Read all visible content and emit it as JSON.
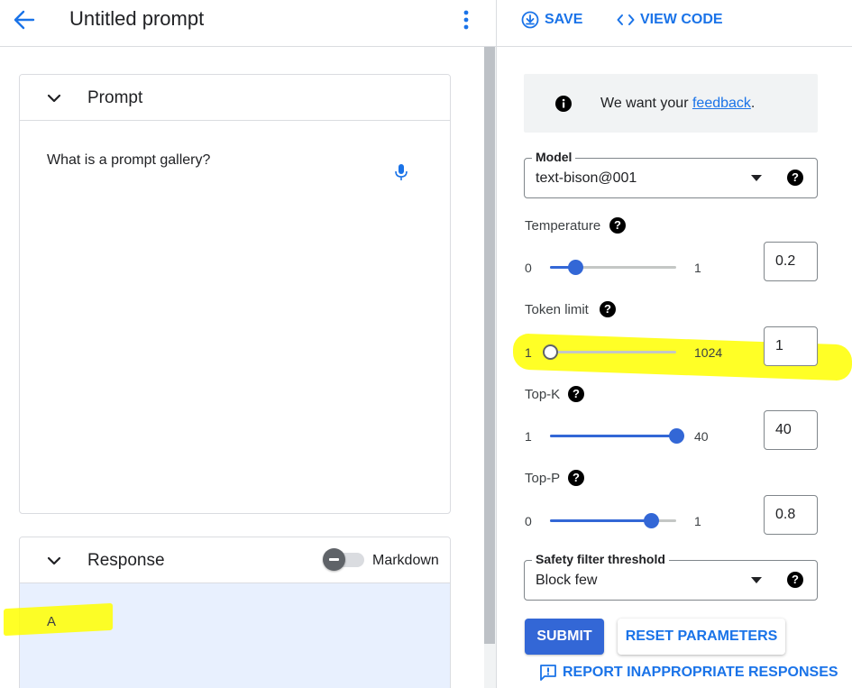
{
  "header": {
    "title": "Untitled prompt",
    "save_label": "SAVE",
    "view_code_label": "VIEW CODE"
  },
  "prompt_card": {
    "title": "Prompt",
    "text": "What is a prompt gallery?"
  },
  "response_card": {
    "title": "Response",
    "markdown_label": "Markdown",
    "markdown_enabled": false,
    "text": "A"
  },
  "feedback": {
    "prefix": "We want your ",
    "link": "feedback",
    "suffix": "."
  },
  "model": {
    "label": "Model",
    "value": "text-bison@001"
  },
  "parameters": {
    "temperature": {
      "label": "Temperature",
      "min": "0",
      "max": "1",
      "value": "0.2",
      "fraction": 0.2
    },
    "token_limit": {
      "label": "Token limit",
      "min": "1",
      "max": "1024",
      "value": "1",
      "fraction": 0.0
    },
    "top_k": {
      "label": "Top-K",
      "min": "1",
      "max": "40",
      "value": "40",
      "fraction": 1.0
    },
    "top_p": {
      "label": "Top-P",
      "min": "0",
      "max": "1",
      "value": "0.8",
      "fraction": 0.8
    }
  },
  "safety": {
    "label": "Safety filter threshold",
    "value": "Block few"
  },
  "actions": {
    "submit_label": "SUBMIT",
    "reset_label": "RESET PARAMETERS",
    "report_label": "REPORT INAPPROPRIATE RESPONSES"
  },
  "help_glyph": "?",
  "icons": [
    "arrow-back-icon",
    "more-vert-icon",
    "chevron-down-icon",
    "mic-icon",
    "download-icon",
    "code-icon",
    "info-icon",
    "help-icon",
    "report-icon"
  ],
  "colors": {
    "accent": "#1a73e8",
    "slider": "#3367d6",
    "highlight": "#ffff00",
    "response_bg": "#e8f0fe"
  }
}
